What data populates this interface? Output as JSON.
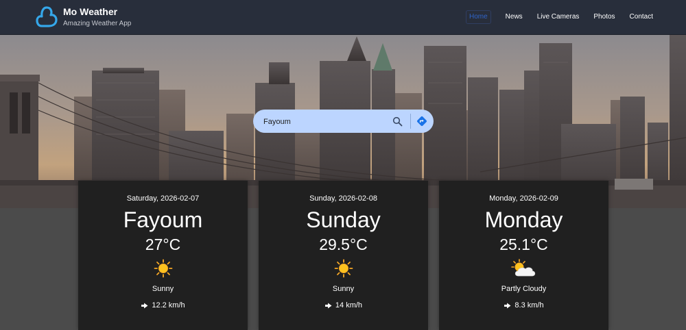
{
  "app": {
    "title": "Mo Weather",
    "subtitle": "Amazing Weather App"
  },
  "nav": {
    "items": [
      "Home",
      "News",
      "Live Cameras",
      "Photos",
      "Contact"
    ],
    "active": "Home"
  },
  "search": {
    "value": "Fayoum",
    "search_icon": "search-icon",
    "directions_icon": "directions-icon"
  },
  "forecast": [
    {
      "date": "Saturday, 2026-02-07",
      "heading": "Fayoum",
      "temp": "27°C",
      "icon": "sun-icon",
      "condition": "Sunny",
      "wind": "12.2 km/h"
    },
    {
      "date": "Sunday, 2026-02-08",
      "heading": "Sunday",
      "temp": "29.5°C",
      "icon": "sun-icon",
      "condition": "Sunny",
      "wind": "14 km/h"
    },
    {
      "date": "Monday, 2026-02-09",
      "heading": "Monday",
      "temp": "25.1°C",
      "icon": "partly-cloudy-icon",
      "condition": "Partly Cloudy",
      "wind": "8.3 km/h"
    }
  ],
  "colors": {
    "navbar": "#282e3b",
    "accent": "#2f64c9",
    "search_bg": "#bcd5ff",
    "card_bg": "#202020"
  }
}
